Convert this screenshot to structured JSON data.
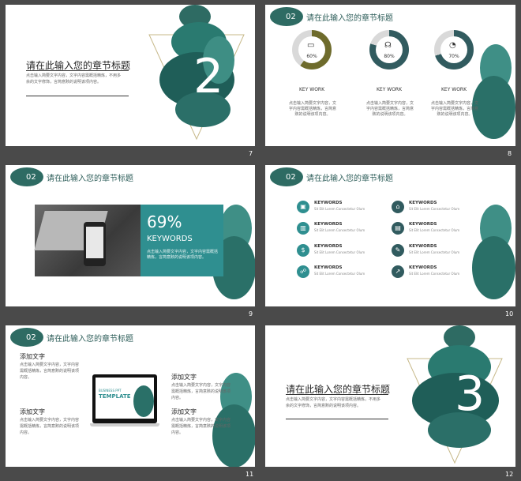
{
  "colors": {
    "teal": "#2f8f90",
    "dark_teal": "#2e6b63",
    "olive": "#6e6b2c",
    "slate": "#315b5f",
    "gold_line": "#c7b98a"
  },
  "slide7": {
    "number": "7",
    "title": "请在此输入您的章节标题",
    "desc1": "点击输入简要文字内容，文字内容需概括精炼，不用多",
    "desc2": "余的文字修饰，言简意赅的说明该项内容。",
    "big_num": "2"
  },
  "slide8": {
    "number": "8",
    "badge": "02",
    "title": "请在此输入您的章节标题",
    "items": [
      {
        "pct": "60%",
        "icon": "laptop-icon",
        "label": "KEY WORK",
        "desc": "点击输入简要文字内容，文字内容需概括精炼，言简意赅的说明该项内容。"
      },
      {
        "pct": "80%",
        "icon": "headphones-icon",
        "label": "KEY WORK",
        "desc": "点击输入简要文字内容，文字内容需概括精炼，言简意赅的说明该项内容。"
      },
      {
        "pct": "70%",
        "icon": "pie-icon",
        "label": "KEY WORK",
        "desc": "点击输入简要文字内容，文字内容需概括精炼，言简意赅的说明该项内容。"
      }
    ]
  },
  "slide9": {
    "number": "9",
    "badge": "02",
    "title": "请在此输入您的章节标题",
    "pct": "69%",
    "keywords": "KEYWORDS",
    "desc": "点击输入简要文字内容，文字内容需概括精炼，言简意赅的说明该项内容。"
  },
  "slide10": {
    "number": "10",
    "badge": "02",
    "title": "请在此输入您的章节标题",
    "left": [
      {
        "label": "KEYWORDS",
        "desc": "Sit Elit Lorem Consectetur Olum",
        "icon": "presentation-icon"
      },
      {
        "label": "KEYWORDS",
        "desc": "Sit Elit Lorem Consectetur Olum",
        "icon": "bar-chart-icon"
      },
      {
        "label": "KEYWORDS",
        "desc": "Sit Elit Lorem Consectetur Olum",
        "icon": "money-icon"
      },
      {
        "label": "KEYWORDS",
        "desc": "Sit Elit Lorem Consectetur Olum",
        "icon": "people-icon"
      }
    ],
    "right": [
      {
        "label": "KEYWORDS",
        "desc": "Sit Elit Lorem Consectetur Olum",
        "icon": "home-icon"
      },
      {
        "label": "KEYWORDS",
        "desc": "Sit Elit Lorem Consectetur Olum",
        "icon": "growth-icon"
      },
      {
        "label": "KEYWORDS",
        "desc": "Sit Elit Lorem Consectetur Olum",
        "icon": "edit-icon"
      },
      {
        "label": "KEYWORDS",
        "desc": "Sit Elit Lorem Consectetur Olum",
        "icon": "trend-icon"
      }
    ]
  },
  "slide11": {
    "number": "11",
    "badge": "02",
    "title": "请在此输入您的章节标题",
    "left_head1": "添加文字",
    "left_body1": "点击输入简要文字内容，文字内容需概括精炼，言简意赅的说明该项内容。",
    "left_head2": "添加文字",
    "left_body2": "点击输入简要文字内容，文字内容需概括精炼，言简意赅的说明该项内容。",
    "right_head1": "添加文字",
    "right_body1": "点击输入简要文字内容，文字内容需概括精炼，言简意赅的说明该项内容。",
    "right_head2": "添加文字",
    "right_body2": "点击输入简要文字内容，文字内容需概括精炼，言简意赅的说明该项内容。",
    "screen_small": "BUSINESS PPT",
    "screen_big": "TEMPLATE"
  },
  "slide12": {
    "number": "12",
    "title": "请在此输入您的章节标题",
    "desc1": "点击输入简要文字内容，文字内容需概括精炼，不用多",
    "desc2": "余的文字修饰，言简意赅的说明该项内容。",
    "big_num": "3"
  }
}
